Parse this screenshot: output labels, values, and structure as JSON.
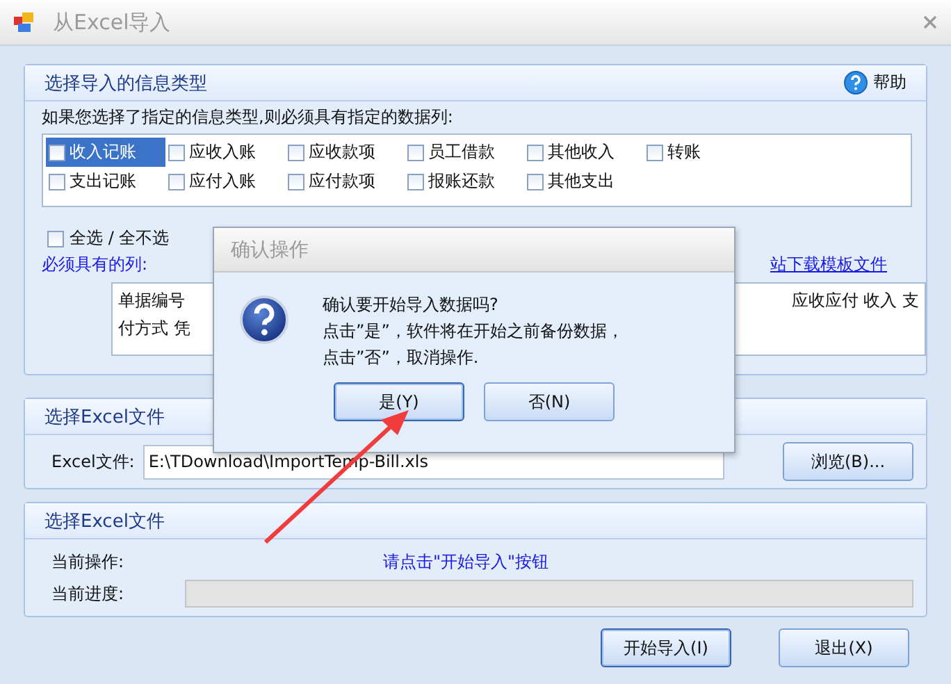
{
  "window": {
    "title": "从Excel导入"
  },
  "type_group": {
    "title": "选择导入的信息类型",
    "help": "帮助",
    "instruction": "如果您选择了指定的信息类型,则必须具有指定的数据列:",
    "types": [
      {
        "label": "收入记账",
        "checked": false,
        "selected": true
      },
      {
        "label": "应收入账",
        "checked": false,
        "selected": false
      },
      {
        "label": "应收款项",
        "checked": false,
        "selected": false
      },
      {
        "label": "员工借款",
        "checked": false,
        "selected": false
      },
      {
        "label": "其他收入",
        "checked": false,
        "selected": false
      },
      {
        "label": "转账",
        "checked": false,
        "selected": false
      },
      {
        "label": "支出记账",
        "checked": false,
        "selected": false
      },
      {
        "label": "应付入账",
        "checked": false,
        "selected": false
      },
      {
        "label": "应付款项",
        "checked": false,
        "selected": false
      },
      {
        "label": "报账还款",
        "checked": false,
        "selected": false
      },
      {
        "label": "其他支出",
        "checked": false,
        "selected": false
      }
    ],
    "select_all": {
      "label": "全选 / 全不选",
      "checked": false
    },
    "required_label": "必须具有的列:",
    "template_link": "站下载模板文件",
    "required_columns": {
      "left": [
        "单据编号",
        "付方式 凭"
      ],
      "right": "应收应付 收入 支"
    }
  },
  "file_group": {
    "title": "选择Excel文件",
    "label": "Excel文件:",
    "value": "E:\\TDownload\\ImportTemp-Bill.xls",
    "browse": "浏览(B)..."
  },
  "progress_group": {
    "title": "选择Excel文件",
    "operation_label": "当前操作:",
    "operation": "请点击\"开始导入\"按钮",
    "progress_label": "当前进度:",
    "level": 0
  },
  "buttons": [
    {
      "label": "开始导入(I)",
      "selected": true
    },
    {
      "label": "退出(X)",
      "selected": false
    }
  ],
  "dialog": {
    "title": "确认操作",
    "lines": [
      "确认要开始导入数据吗?",
      "点击”是”，软件将在开始之前备份数据，",
      "点击”否”，取消操作."
    ],
    "buttons": [
      {
        "label": "是(Y)",
        "selected": true
      },
      {
        "label": "否(N)",
        "selected": false
      }
    ]
  }
}
